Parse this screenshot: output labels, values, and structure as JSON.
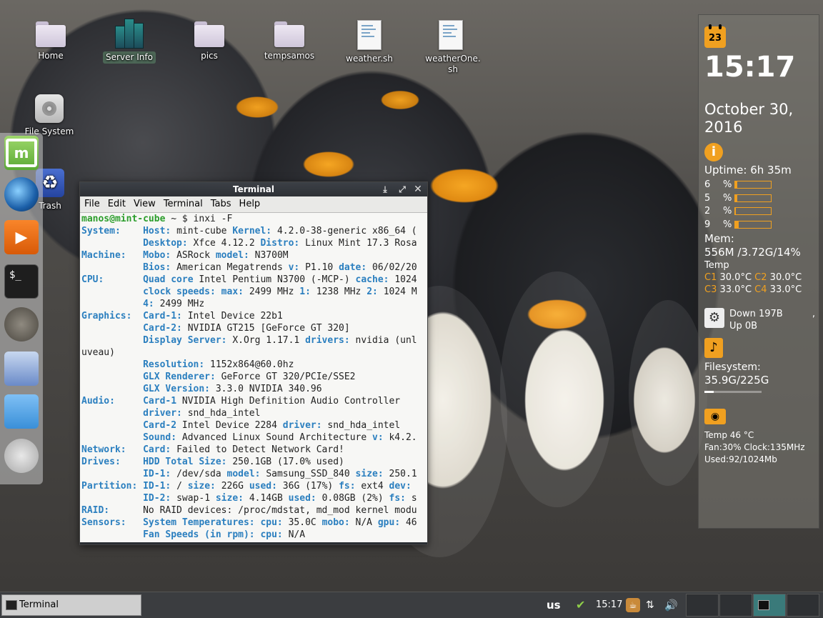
{
  "desktop": {
    "icons": [
      {
        "label": "Home"
      },
      {
        "label": "Server Info"
      },
      {
        "label": "pics"
      },
      {
        "label": "tempsamos"
      },
      {
        "label": "weather.sh"
      },
      {
        "label": "weatherOne.sh"
      },
      {
        "label": "File System"
      },
      {
        "label": "Trash"
      }
    ]
  },
  "terminal": {
    "title": "Terminal",
    "menu": [
      "File",
      "Edit",
      "View",
      "Terminal",
      "Tabs",
      "Help"
    ],
    "prompt_user": "manos@mint-cube",
    "prompt_rest": " ~ $ ",
    "command": "inxi -F",
    "lines": [
      {
        "a": "System:    ",
        "b": "Host: ",
        "c": "mint-cube ",
        "d": "Kernel: ",
        "e": "4.2.0-38-generic x86_64 ("
      },
      {
        "a": "           ",
        "b": "Desktop: ",
        "c": "Xfce 4.12.2 ",
        "d": "Distro: ",
        "e": "Linux Mint 17.3 Rosa"
      },
      {
        "a": "Machine:   ",
        "b": "Mobo: ",
        "c": "ASRock ",
        "d": "model: ",
        "e": "N3700M"
      },
      {
        "a": "           ",
        "b": "Bios: ",
        "c": "American Megatrends ",
        "d": "v: ",
        "e": "P1.10 ",
        "f": "date: ",
        "g": "06/02/20"
      },
      {
        "a": "CPU:       ",
        "b": "Quad core ",
        "c": "Intel Pentium N3700 (-MCP-) ",
        "d": "cache: ",
        "e": "1024"
      },
      {
        "a": "           ",
        "b": "clock speeds: max: ",
        "c": "2499 MHz ",
        "d": "1: ",
        "e": "1238 MHz ",
        "f": "2: ",
        "g": "1024 M"
      },
      {
        "a": "           ",
        "b": "4: ",
        "c": "2499 MHz"
      },
      {
        "a": "Graphics:  ",
        "b": "Card-1: ",
        "c": "Intel Device 22b1"
      },
      {
        "a": "           ",
        "b": "Card-2: ",
        "c": "NVIDIA GT215 [GeForce GT 320]"
      },
      {
        "a": "           ",
        "b": "Display Server: ",
        "c": "X.Org 1.17.1 ",
        "d": "drivers: ",
        "e": "nvidia (unl"
      },
      {
        "a": "",
        "c": "uveau)"
      },
      {
        "a": "           ",
        "b": "Resolution: ",
        "c": "1152x864@60.0hz"
      },
      {
        "a": "           ",
        "b": "GLX Renderer: ",
        "c": "GeForce GT 320/PCIe/SSE2"
      },
      {
        "a": "           ",
        "b": "GLX Version: ",
        "c": "3.3.0 NVIDIA 340.96"
      },
      {
        "a": "Audio:     ",
        "b": "Card-1 ",
        "c": "NVIDIA High Definition Audio Controller"
      },
      {
        "a": "           ",
        "b": "driver: ",
        "c": "snd_hda_intel"
      },
      {
        "a": "           ",
        "b": "Card-2 ",
        "c": "Intel Device 2284 ",
        "d": "driver: ",
        "e": "snd_hda_intel"
      },
      {
        "a": "           ",
        "b": "Sound: ",
        "c": "Advanced Linux Sound Architecture ",
        "d": "v: ",
        "e": "k4.2."
      },
      {
        "a": "Network:   ",
        "b": "Card: ",
        "c": "Failed to Detect Network Card!"
      },
      {
        "a": "Drives:    ",
        "b": "HDD Total Size: ",
        "c": "250.1GB (17.0% used)"
      },
      {
        "a": "           ",
        "b": "ID-1: ",
        "c": "/dev/sda ",
        "d": "model: ",
        "e": "Samsung_SSD_840 ",
        "f": "size: ",
        "g": "250.1"
      },
      {
        "a": "Partition: ",
        "b": "ID-1: ",
        "c": "/ ",
        "d": "size: ",
        "e": "226G ",
        "f": "used: ",
        "g": "36G (17%) ",
        "h": "fs: ",
        "i": "ext4 ",
        "j": "dev:"
      },
      {
        "a": "           ",
        "b": "ID-2: ",
        "c": "swap-1 ",
        "d": "size: ",
        "e": "4.14GB ",
        "f": "used: ",
        "g": "0.08GB (2%) ",
        "h": "fs: ",
        "i": "s"
      },
      {
        "a": "RAID:      ",
        "c": "No RAID devices: /proc/mdstat, md_mod kernel modu"
      },
      {
        "a": "Sensors:   ",
        "b": "System Temperatures: cpu: ",
        "c": "35.0C ",
        "d": "mobo: ",
        "e": "N/A ",
        "f": "gpu: ",
        "g": "46"
      },
      {
        "a": "           ",
        "b": "Fan Speeds (in rpm): cpu: ",
        "c": "N/A"
      }
    ]
  },
  "conky": {
    "cal_day": "23",
    "time": "15:17",
    "date": "October 30,",
    "year": "2016",
    "uptime": "Uptime: 6h 35m",
    "cpu": [
      {
        "label": "6",
        "pct": "%",
        "value": 6
      },
      {
        "label": "5",
        "pct": "%",
        "value": 5
      },
      {
        "label": "2",
        "pct": "%",
        "value": 2
      },
      {
        "label": "9",
        "pct": "%",
        "value": 9
      }
    ],
    "mem_label": "Mem:",
    "mem": "556M /3.72G/14%",
    "temp_label": "Temp",
    "temps": [
      {
        "k": "C1",
        "v": "30.0°C",
        "k2": "C2",
        "v2": "30.0°C"
      },
      {
        "k": "C3",
        "v": "33.0°C",
        "k2": "C4",
        "v2": "33.0°C"
      }
    ],
    "net_down": "Down 197B",
    "net_sep": ",",
    "net_up": "Up 0B",
    "fs_label": "Filesystem:",
    "fs": "35.9G/225G",
    "fs_fraction": 0.16,
    "gpu_temp": "Temp 46 °C",
    "gpu_fan": "Fan:30% Clock:135MHz",
    "gpu_used": "Used:92/1024Mb"
  },
  "taskbar": {
    "task_label": "Terminal",
    "layout": "us",
    "clock": "15:17"
  }
}
